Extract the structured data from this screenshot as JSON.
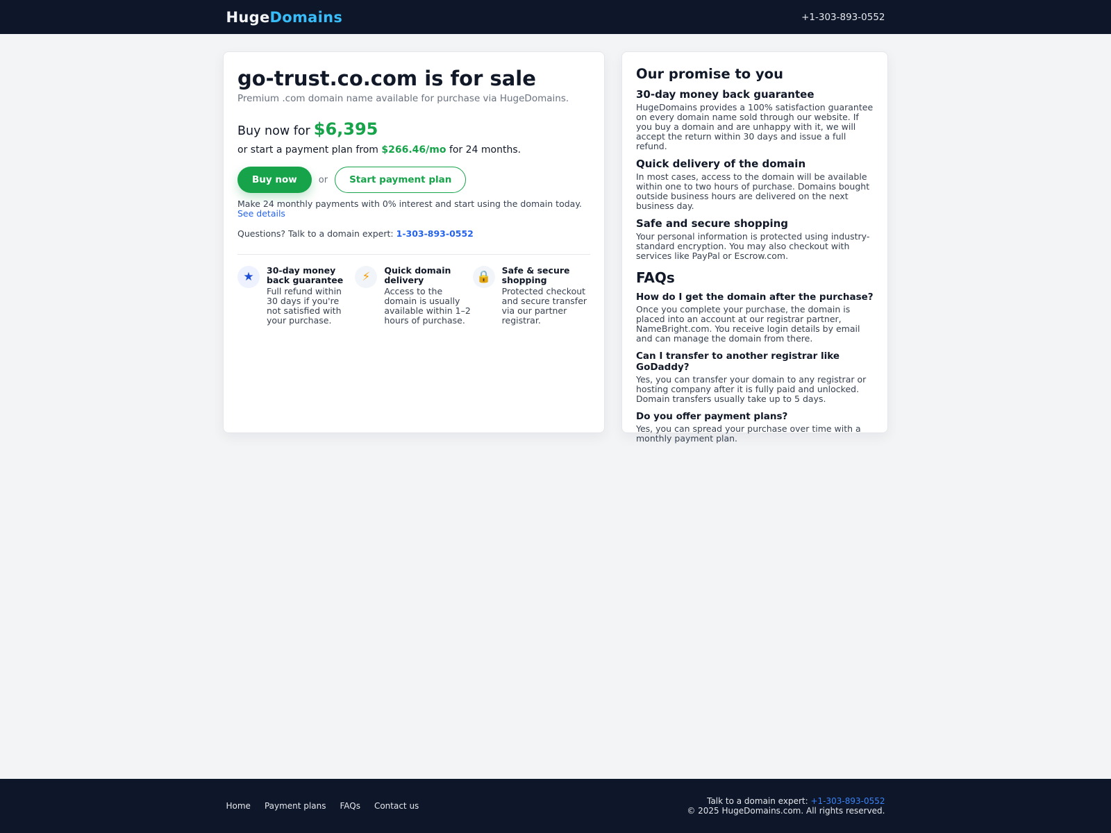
{
  "header": {
    "logo_part1": "Huge",
    "logo_part2": "Domains",
    "phone": "+1-303-893-0552"
  },
  "listing": {
    "title": "go-trust.co.com is for sale",
    "subtitle": "Premium .com domain name available for purchase via HugeDomains.",
    "buy_prefix": "Buy now for",
    "price": "$6,395",
    "plan_prefix": "or start a payment plan from",
    "plan_price": "$266.46/mo",
    "plan_suffix": "for 24 months.",
    "buy_button": "Buy now",
    "or_text": "or",
    "plan_button": "Start payment plan",
    "note": "Make 24 monthly payments with 0% interest and start using the domain today.",
    "note_link": "See details",
    "questions_prefix": "Questions? Talk to a domain expert:",
    "questions_phone": "1-303-893-0552"
  },
  "features": [
    {
      "icon": "star-icon",
      "title": "30-day money back guarantee",
      "desc": "Full refund within 30 days if you're not satisfied with your purchase."
    },
    {
      "icon": "lightning-icon",
      "title": "Quick domain delivery",
      "desc": "Access to the domain is usually available within 1–2 hours of purchase."
    },
    {
      "icon": "lock-icon",
      "title": "Safe & secure shopping",
      "desc": "Protected checkout and secure transfer via our partner registrar."
    }
  ],
  "promise": {
    "heading": "Our promise to you",
    "items": [
      {
        "title": "30-day money back guarantee",
        "text": "HugeDomains provides a 100% satisfaction guarantee on every domain name sold through our website. If you buy a domain and are unhappy with it, we will accept the return within 30 days and issue a full refund."
      },
      {
        "title": "Quick delivery of the domain",
        "text": "In most cases, access to the domain will be available within one to two hours of purchase. Domains bought outside business hours are delivered on the next business day."
      },
      {
        "title": "Safe and secure shopping",
        "text": "Your personal information is protected using industry-standard encryption. You may also checkout with services like PayPal or Escrow.com."
      }
    ]
  },
  "faqs": {
    "heading": "FAQs",
    "items": [
      {
        "q": "How do I get the domain after the purchase?",
        "a": "Once you complete your purchase, the domain is placed into an account at our registrar partner, NameBright.com. You receive login details by email and can manage the domain from there."
      },
      {
        "q": "Can I transfer to another registrar like GoDaddy?",
        "a": "Yes, you can transfer your domain to any registrar or hosting company after it is fully paid and unlocked. Domain transfers usually take up to 5 days."
      },
      {
        "q": "Do you offer payment plans?",
        "a": "Yes, you can spread your purchase over time with a monthly payment plan."
      }
    ]
  },
  "footer": {
    "links": [
      "Home",
      "Payment plans",
      "FAQs",
      "Contact us"
    ],
    "expert_prefix": "Talk to a domain expert:",
    "expert_phone": "+1-303-893-0552",
    "copyright": "© 2025 HugeDomains.com. All rights reserved."
  }
}
